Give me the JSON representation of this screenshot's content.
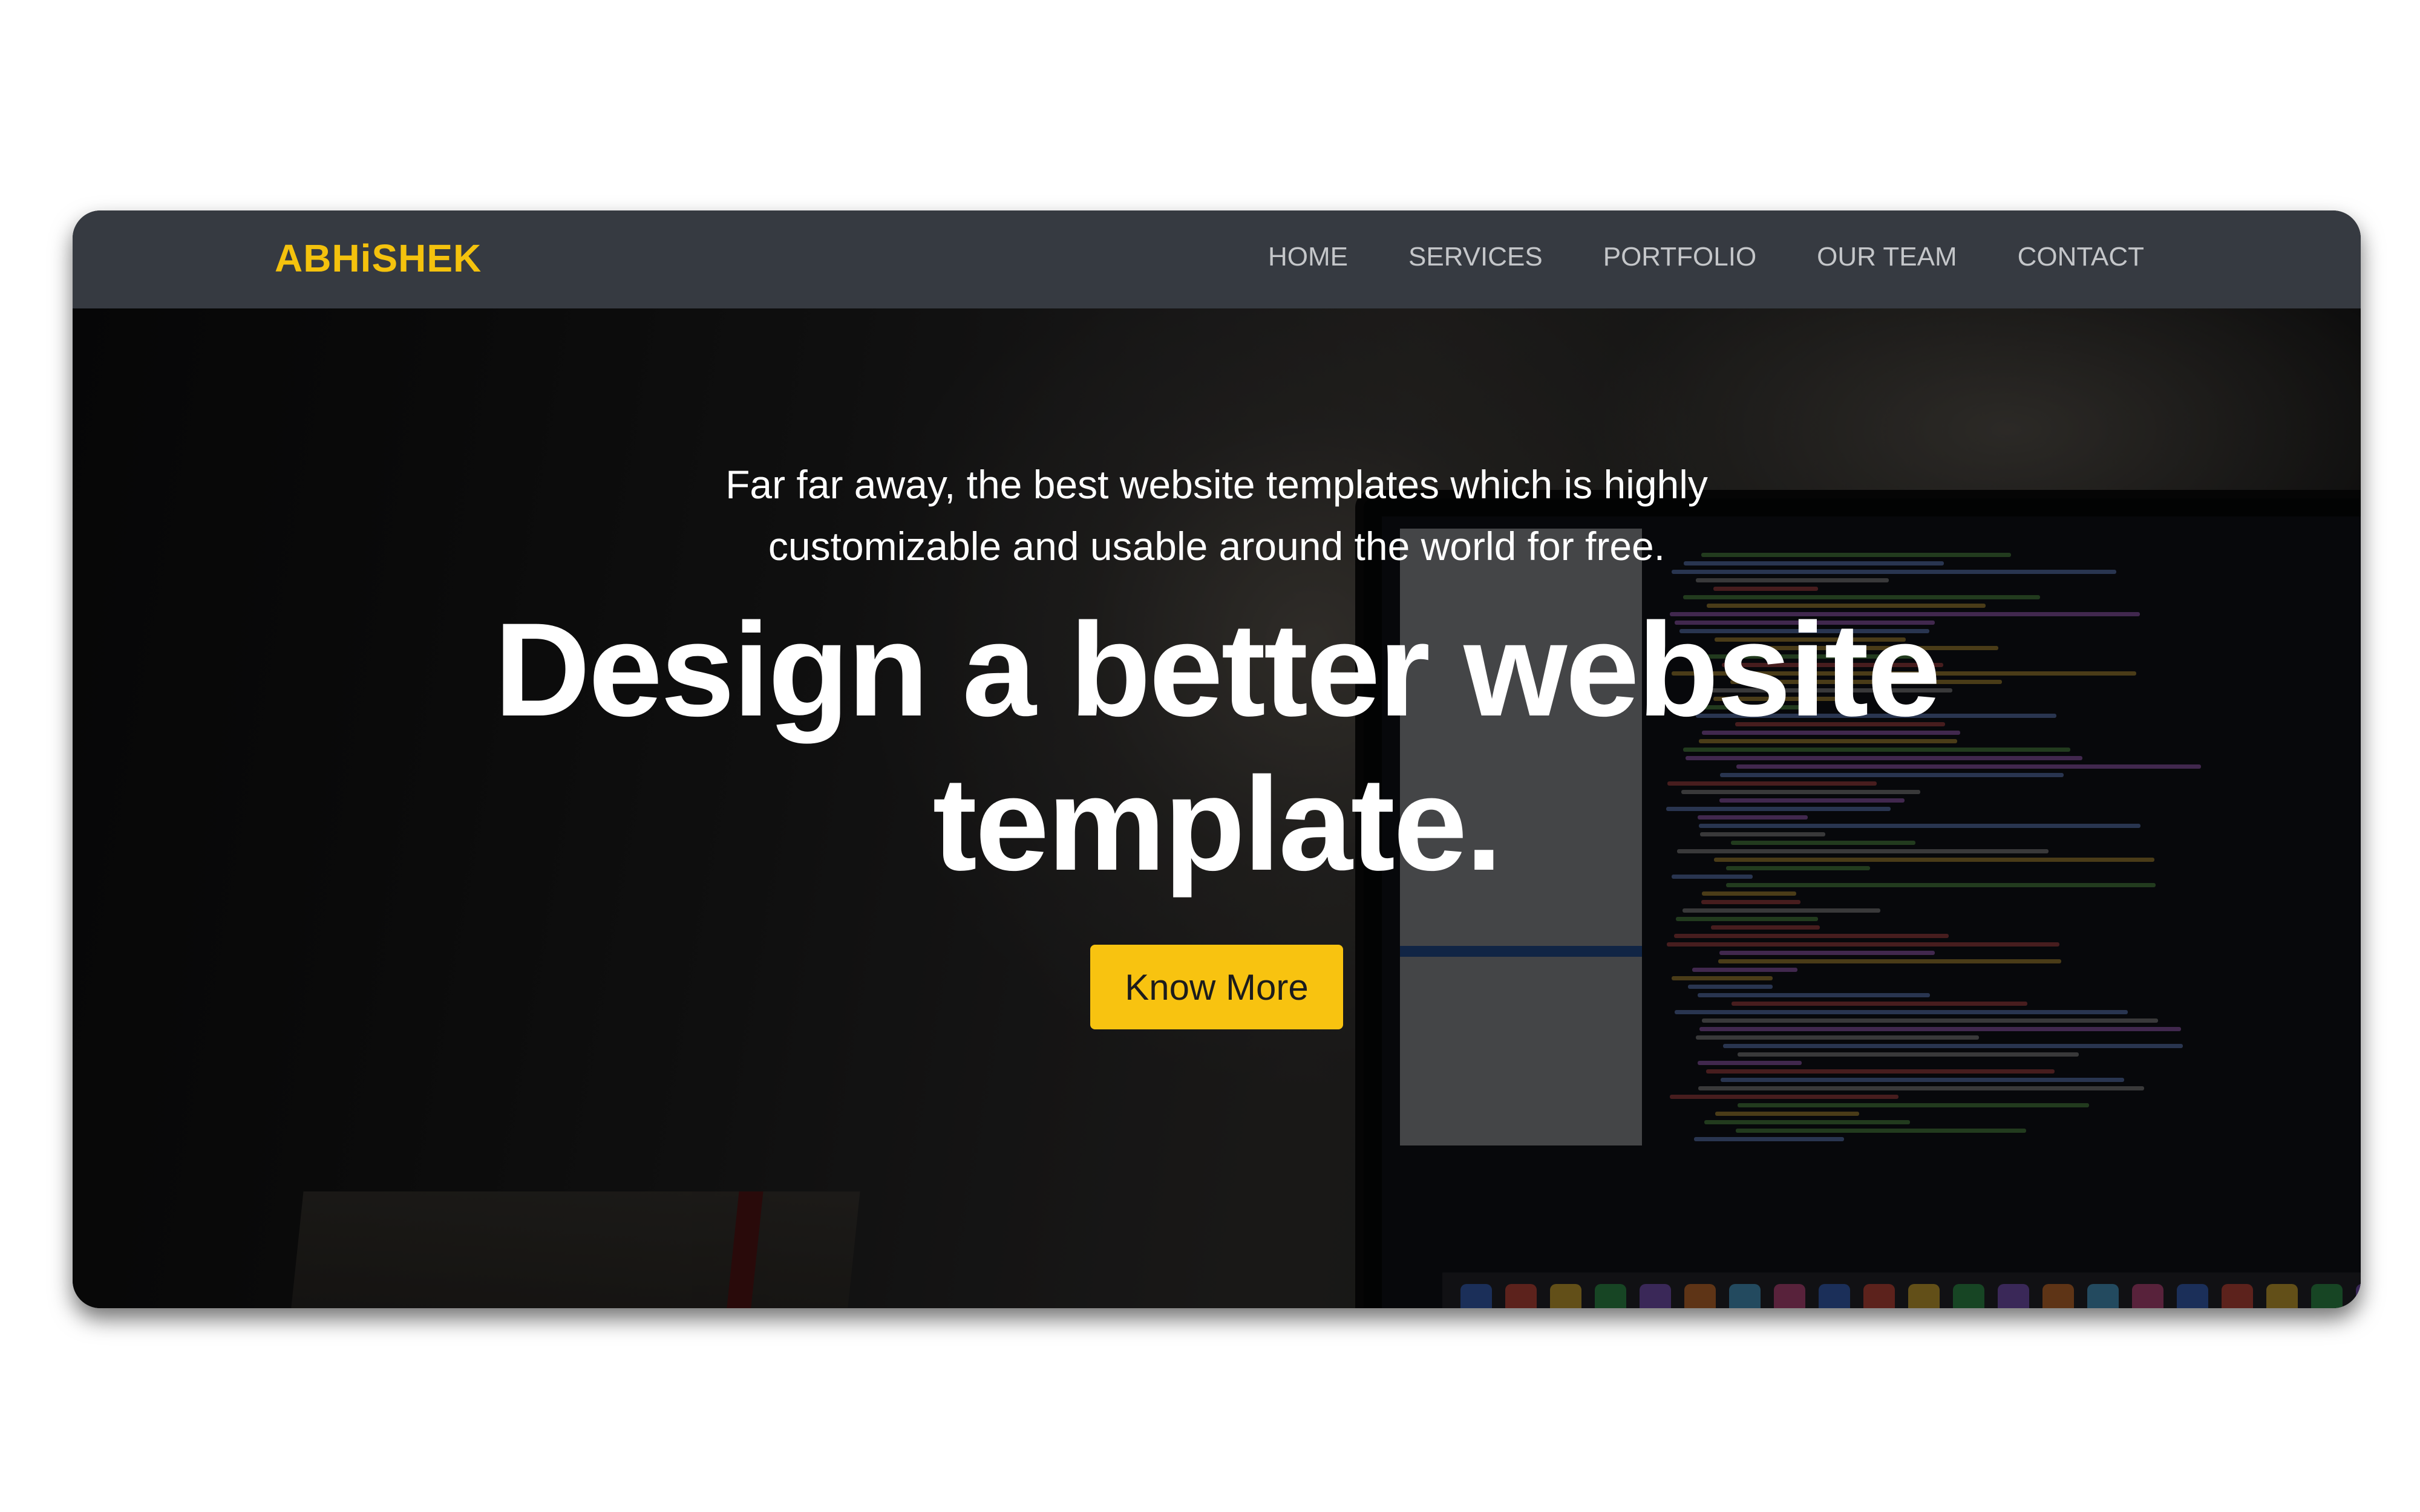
{
  "navbar": {
    "brand": "ABHiSHEK",
    "links": [
      "HOME",
      "SERVICES",
      "PORTFOLIO",
      "OUR TEAM",
      "CONTACT"
    ]
  },
  "hero": {
    "subtitle_line1": "Far far away, the best website templates which is highly",
    "subtitle_line2": "customizable and usable around the world for free.",
    "headline_line1": "Design a better website",
    "headline_line2": "template.",
    "cta_label": "Know More",
    "background_image": "desk-with-laptop-showing-code-editor"
  },
  "colors": {
    "brand": "#f4c20d",
    "navbar_bg": "#363a41",
    "nav_text": "#c4c6c9",
    "cta_bg": "#f8c310",
    "text": "#ffffff"
  }
}
